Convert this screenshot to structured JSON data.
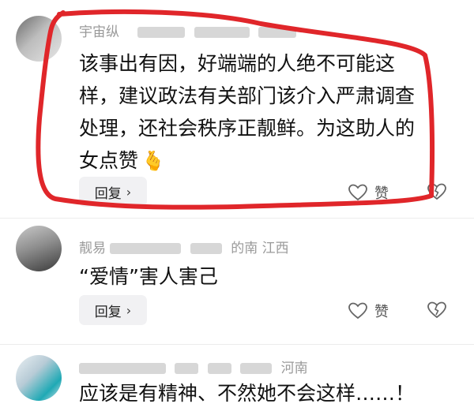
{
  "comments": [
    {
      "user_fragment": "宇宙纵",
      "location": "",
      "text_lines": [
        "该事出有因，好端端的人绝不可能这",
        "样，建议政法有关部门该介入严肃调查",
        "处理，还社会秩序正靓鲜。为这助人的",
        "女点赞"
      ],
      "emoji": "🫰",
      "reply_label": "回复",
      "like_label": "赞"
    },
    {
      "user_fragment": "靓易",
      "location": "的南 江西",
      "text_lines": [
        "“爱情”害人害己"
      ],
      "reply_label": "回复",
      "like_label": "赞"
    },
    {
      "user_fragment": "",
      "location": "河南",
      "text_lines": [
        "应该是有精神、不然她不会这样……！"
      ]
    }
  ],
  "colors": {
    "highlight": "#e0262a",
    "reply_bg": "#f1f1f3"
  }
}
